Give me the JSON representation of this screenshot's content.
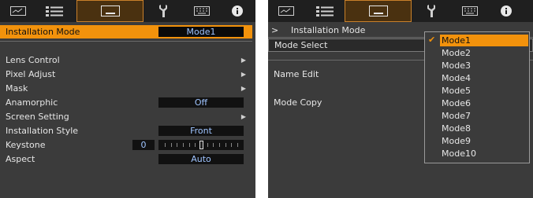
{
  "left": {
    "tabs": [
      {
        "icon": "picture-icon",
        "selected": false
      },
      {
        "icon": "settings-list-icon",
        "selected": false
      },
      {
        "icon": "installation-icon",
        "selected": true
      },
      {
        "icon": "wrench-icon",
        "selected": false
      },
      {
        "icon": "keyboard-icon",
        "selected": false
      },
      {
        "icon": "info-icon",
        "selected": false
      }
    ],
    "highlight": {
      "label": "Installation Mode",
      "value": "Mode1"
    },
    "items": [
      {
        "label": "Lens Control",
        "arrow": "▶"
      },
      {
        "label": "Pixel Adjust",
        "arrow": "▶"
      },
      {
        "label": "Mask",
        "arrow": "▶"
      },
      {
        "label": "Anamorphic",
        "value": "Off"
      },
      {
        "label": "Screen Setting",
        "arrow": "▶"
      },
      {
        "label": "Installation Style",
        "value": "Front"
      },
      {
        "label": "Keystone",
        "value": "0",
        "slider_level": 0
      },
      {
        "label": "Aspect",
        "value": "Auto"
      }
    ]
  },
  "right": {
    "breadcrumb": {
      "prefix": ">",
      "title": "Installation Mode"
    },
    "items": [
      {
        "label": "Mode Select"
      },
      {
        "label": "Name Edit"
      },
      {
        "label": "Mode Copy"
      }
    ],
    "dropdown": {
      "options": [
        "Mode1",
        "Mode2",
        "Mode3",
        "Mode4",
        "Mode5",
        "Mode6",
        "Mode7",
        "Mode8",
        "Mode9",
        "Mode10"
      ],
      "selected": "Mode1",
      "check": "✔"
    }
  },
  "colors": {
    "accent": "#f2920c",
    "panel": "#3b3b3b",
    "tabbar": "#1f1f1f",
    "value_text": "#9fc4ff"
  }
}
